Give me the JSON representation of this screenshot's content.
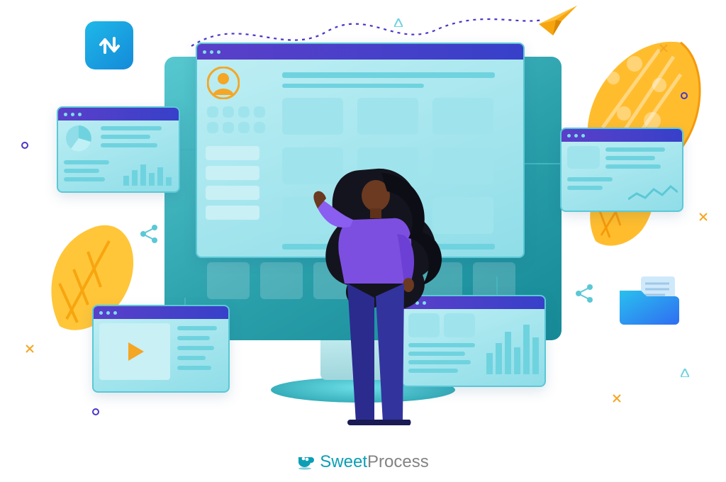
{
  "brand": {
    "part1": "Sweet",
    "part2": "Process"
  },
  "palette": {
    "purple": "#4a36c7",
    "teal": "#5bc8d6",
    "teal_dark": "#2aa0ab",
    "orange_light": "#ffc13b",
    "orange_dark": "#f59a0b",
    "blue_grad_a": "#1fb8e8",
    "blue_grad_b": "#148ad9"
  },
  "badges": {
    "swap_arrows": "↑↓"
  },
  "icons": {
    "play": "play-icon",
    "pie": "pie-chart-icon",
    "bars": "bar-chart-icon",
    "avatar": "avatar-icon",
    "share": "share-icon",
    "folder": "folder-icon",
    "paper_plane": "paper-plane-icon"
  }
}
